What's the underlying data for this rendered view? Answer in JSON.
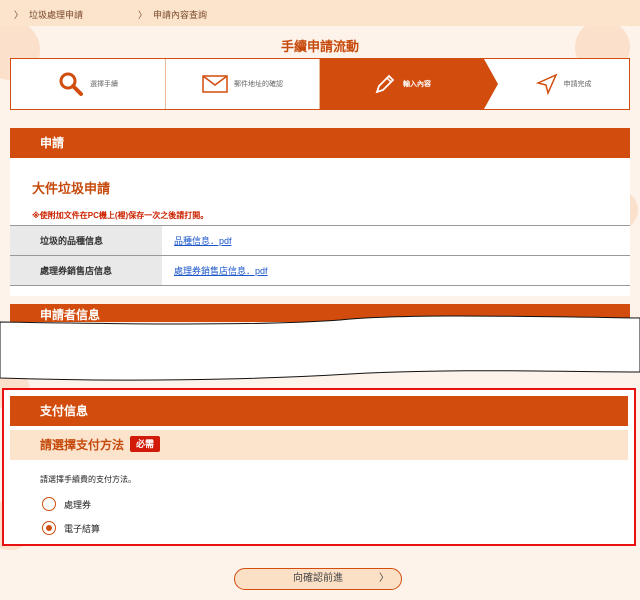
{
  "breadcrumb": {
    "items": [
      "垃圾處理申請",
      "申請內容查詢"
    ],
    "separator": "〉"
  },
  "page": {
    "title": "手續申請流動"
  },
  "steps": [
    {
      "label": "選擇手續",
      "icon": "search-icon",
      "active": false
    },
    {
      "label": "郵件地址的確認",
      "icon": "envelope-icon",
      "active": false
    },
    {
      "label": "輸入內容",
      "icon": "pencil-icon",
      "active": true
    },
    {
      "label": "申請完成",
      "icon": "send-icon",
      "active": false
    }
  ],
  "application": {
    "section_title": "申請",
    "subtitle": "大件垃圾申請",
    "note": "※使附加文件在PC機上(裡)保存一次之後請打開。",
    "rows": [
      {
        "label": "垃圾的品種信息",
        "link": "品種信息．pdf"
      },
      {
        "label": "處理券銷售店信息",
        "link": "處理券銷售店信息．pdf"
      }
    ]
  },
  "applicant": {
    "section_title": "申請者信息"
  },
  "payment": {
    "section_title": "支付信息",
    "question": "請選擇支付方法",
    "required_badge": "必需",
    "instruction": "請選擇手續費的支付方法。",
    "options": [
      {
        "label": "處理券",
        "selected": false
      },
      {
        "label": "電子結算",
        "selected": true
      }
    ]
  },
  "actions": {
    "next_label": "向確認前進",
    "next_chevron": "〉"
  },
  "colors": {
    "accent": "#d24c0d",
    "highlight_border": "#e81010",
    "link": "#1a55c9"
  }
}
